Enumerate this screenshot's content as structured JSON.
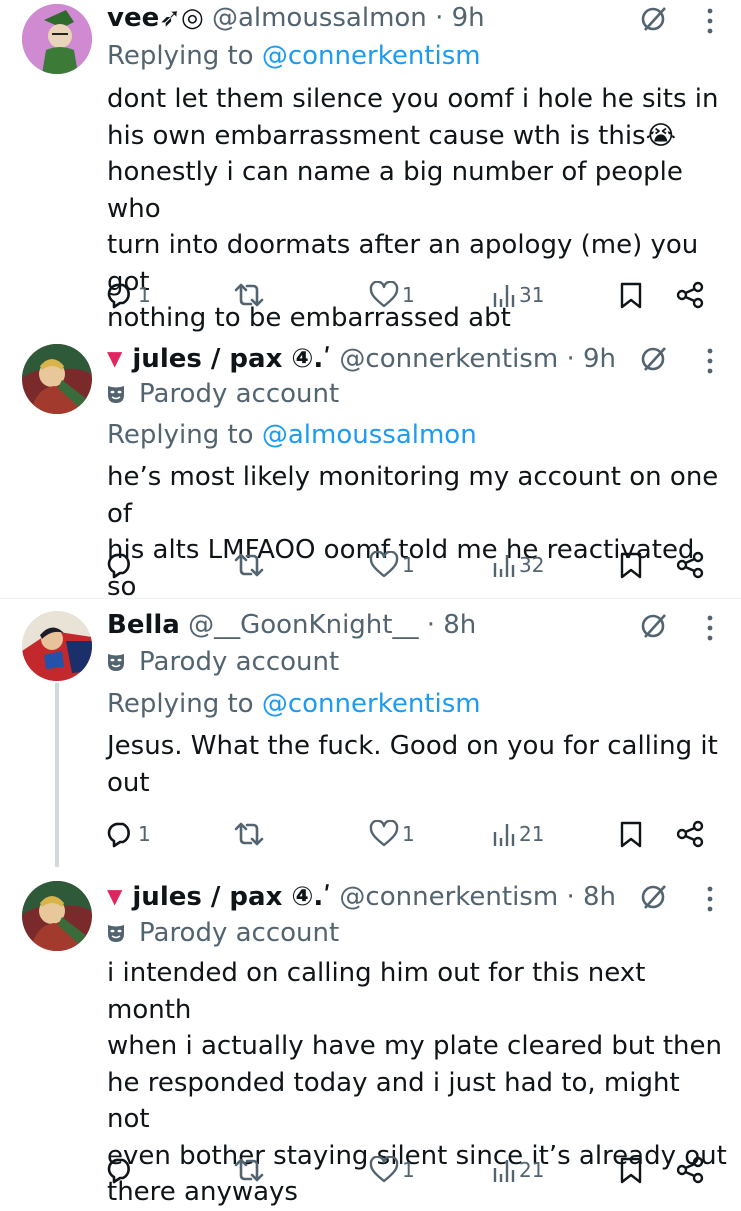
{
  "tweets": [
    {
      "name": "vee➶◎",
      "handle": "@almoussalmon",
      "time": "· 9h",
      "parody": "",
      "replying_prefix": "Replying to ",
      "replying_to": "@connerkentism",
      "body": "dont let them silence you oomf i hole he sits in\nhis own embarrassment cause wth is this😭\nhonestly i can name a big number of people who\nturn into doormats after an apology (me) you got\nnothing to be embarrassed abt",
      "replies": "1",
      "reposts": "",
      "likes": "1",
      "views": "31"
    },
    {
      "name": "jules / pax ④.ʹ",
      "handle": "@connerkentism",
      "time": "· 9h",
      "parody": "Parody account",
      "replying_prefix": "Replying to ",
      "replying_to": "@almoussalmon",
      "body": "he’s most likely monitoring my account on one of\nhis alts LMFAOO oomf told me he reactivated so",
      "replies": "",
      "reposts": "",
      "likes": "1",
      "views": "32"
    },
    {
      "name": "Bella",
      "handle": "@__GoonKnight__",
      "time": "· 8h",
      "parody": "Parody account",
      "replying_prefix": "Replying to ",
      "replying_to": "@connerkentism",
      "body": "Jesus. What the fuck. Good on you for calling it\nout",
      "replies": "1",
      "reposts": "",
      "likes": "1",
      "views": "21"
    },
    {
      "name": "jules / pax ④.ʹ",
      "handle": "@connerkentism",
      "time": "· 8h",
      "parody": "Parody account",
      "replying_prefix": "",
      "replying_to": "",
      "body": "i intended on calling him out for this next month\nwhen i actually have my plate cleared but then\nhe responded today and i just had to, might not\neven bother staying silent since it’s already out\nthere anyways",
      "replies": "",
      "reposts": "",
      "likes": "1",
      "views": "21"
    }
  ],
  "icons": {
    "reply": "reply-icon",
    "repost": "repost-icon",
    "like": "heart-icon",
    "views": "views-icon",
    "bookmark": "bookmark-icon",
    "share": "share-icon",
    "grok": "grok-icon",
    "more": "more-icon",
    "parody": "parody-mask-icon",
    "parody_flag": "red-triangle-icon"
  },
  "colors": {
    "text": "#0f1419",
    "secondary": "#536471",
    "link": "#1d9bf0",
    "flag": "#e0245e"
  }
}
